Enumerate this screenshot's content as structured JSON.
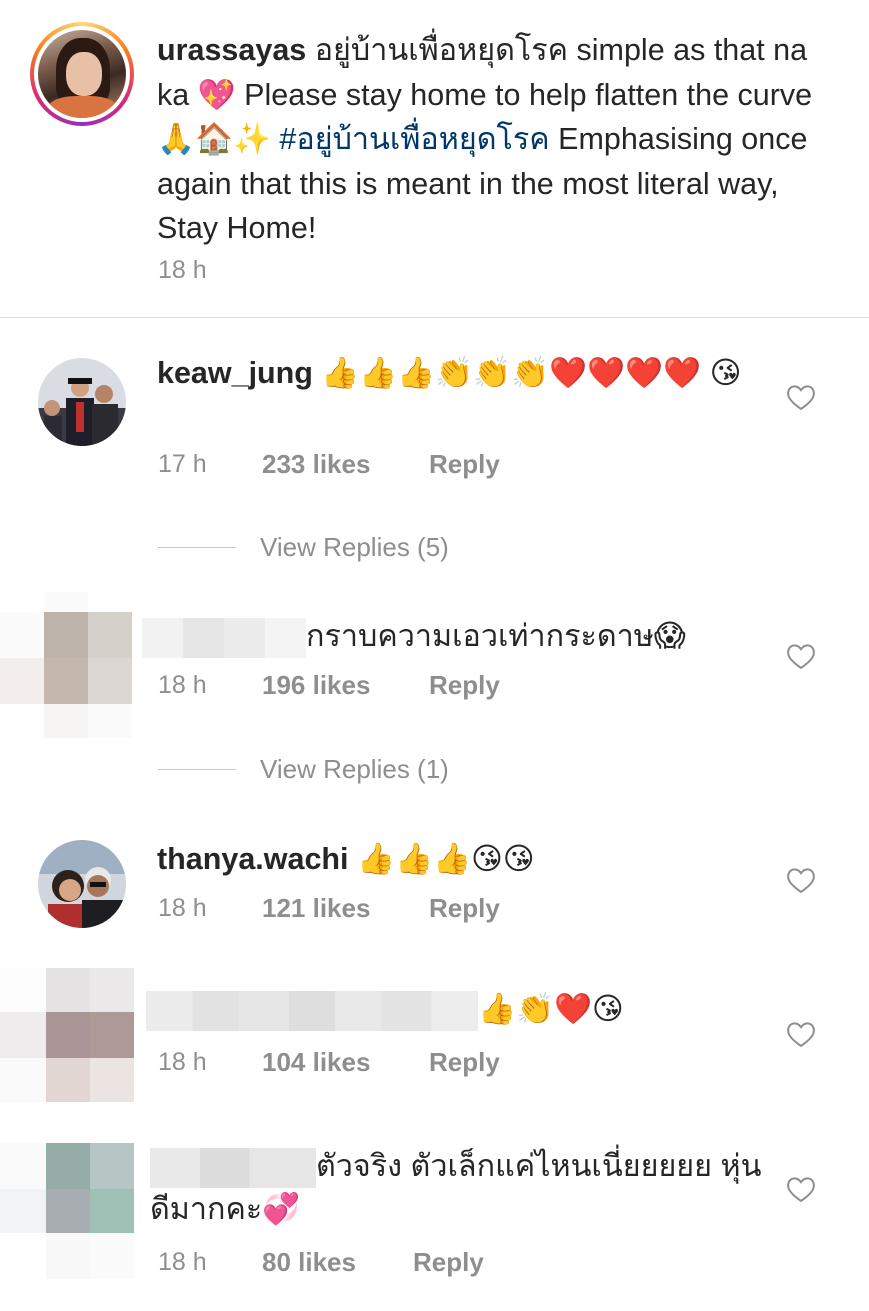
{
  "caption": {
    "username": "urassayas",
    "text_parts": {
      "p1": " อยู่บ้านเพื่อหยุดโรค simple as that na ka ",
      "e1": "💖",
      "p2": " Please stay home to help flatten the curve",
      "e2": "🙏🏠✨",
      "hashtag": " #อยู่บ้านเพื่อหยุดโรค",
      "p3": "  Emphasising once again that this is meant in the most literal way, Stay Home!"
    },
    "time": "18 h"
  },
  "comments": [
    {
      "username": "keaw_jung",
      "text": " 👍👍👍👏👏👏❤️❤️❤️❤️ 😘",
      "time": "17 h",
      "likes": "233 likes",
      "reply": "Reply",
      "view_replies": "View Replies (5)"
    },
    {
      "username": "",
      "text": "กราบความเอวเท่ากระดาษ😱",
      "time": "18 h",
      "likes": "196 likes",
      "reply": "Reply",
      "view_replies": "View Replies (1)"
    },
    {
      "username": "thanya.wachi",
      "text": " 👍👍👍😘😘",
      "time": "18 h",
      "likes": "121 likes",
      "reply": "Reply"
    },
    {
      "username": "",
      "text": "👍👏❤️😘",
      "time": "18 h",
      "likes": "104 likes",
      "reply": "Reply"
    },
    {
      "username": "",
      "text": "ตัวจริง ตัวเล็กแค่ไหนเนี่ยยยยย หุ่นดีมากคะ💞",
      "time": "18 h",
      "likes": "80 likes",
      "reply": "Reply"
    }
  ],
  "icons": {
    "like": "heart-outline-icon"
  },
  "colors": {
    "text": "#262626",
    "meta": "#8e8e8e",
    "hashtag": "#00376b",
    "divider": "#dbdbdb"
  }
}
